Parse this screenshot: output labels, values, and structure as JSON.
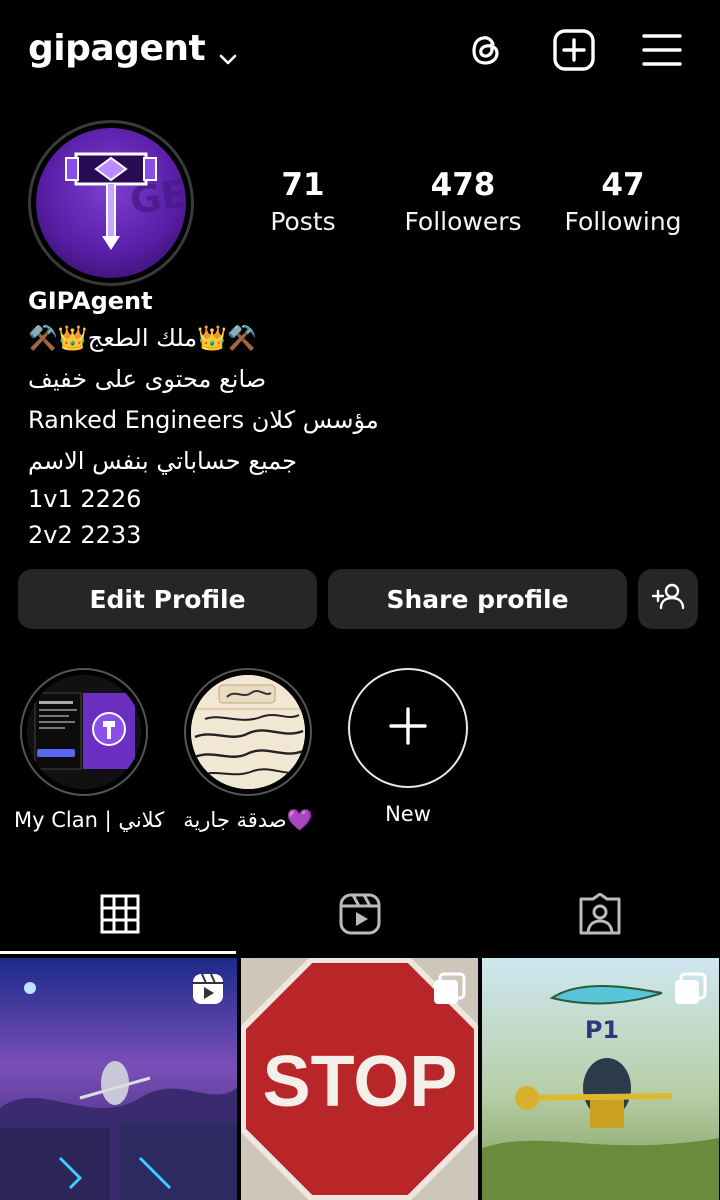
{
  "header": {
    "username": "gipagent",
    "icons": [
      "threads-icon",
      "create-icon",
      "menu-icon"
    ]
  },
  "profile": {
    "stats": [
      {
        "value": "71",
        "label": "Posts"
      },
      {
        "value": "478",
        "label": "Followers"
      },
      {
        "value": "47",
        "label": "Following"
      }
    ],
    "display_name": "GIPAgent",
    "bio_lines": [
      "⚒️👑ملك الطعج👑⚒️",
      "صانع محتوى على خفيف",
      "مؤسس كلان Ranked Engineers",
      "جميع حساباتي بنفس الاسم",
      "1v1 2226",
      "2v2 2233"
    ]
  },
  "actions": {
    "edit_label": "Edit Profile",
    "share_label": "Share profile"
  },
  "highlights": [
    {
      "label": "My Clan | كلاني"
    },
    {
      "label": "صدقة جارية💜"
    },
    {
      "label": "New"
    }
  ],
  "colors": {
    "background": "#000000",
    "button": "#262626",
    "avatar_purple": "#7d3fd0"
  }
}
